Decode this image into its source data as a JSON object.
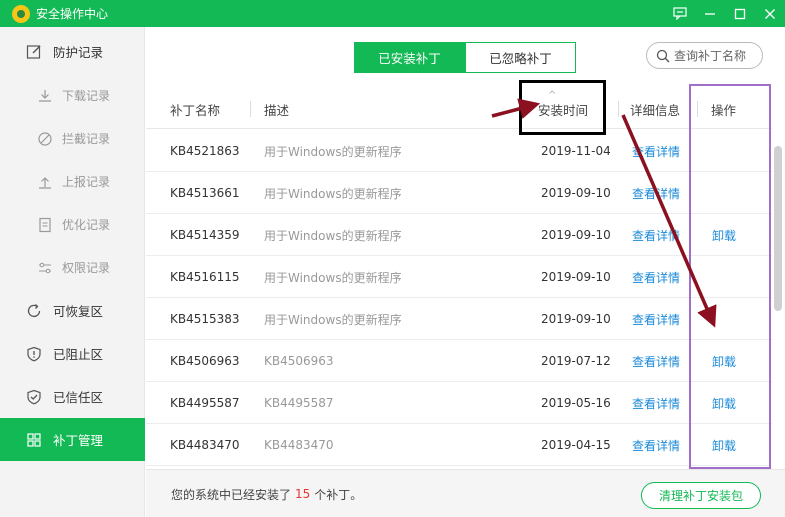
{
  "window": {
    "title": "安全操作中心"
  },
  "sidebar": {
    "items": [
      {
        "label": "防护记录",
        "icon": "edit-icon",
        "level": "top",
        "active": false
      },
      {
        "label": "下载记录",
        "icon": "download-icon",
        "level": "sub",
        "active": false
      },
      {
        "label": "拦截记录",
        "icon": "block-icon",
        "level": "sub",
        "active": false
      },
      {
        "label": "上报记录",
        "icon": "upload-icon",
        "level": "sub",
        "active": false
      },
      {
        "label": "优化记录",
        "icon": "document-icon",
        "level": "sub",
        "active": false
      },
      {
        "label": "权限记录",
        "icon": "sliders-icon",
        "level": "sub",
        "active": false
      },
      {
        "label": "可恢复区",
        "icon": "restore-icon",
        "level": "top",
        "active": false
      },
      {
        "label": "已阻止区",
        "icon": "shield-alert-icon",
        "level": "top",
        "active": false
      },
      {
        "label": "已信任区",
        "icon": "shield-check-icon",
        "level": "top",
        "active": false
      },
      {
        "label": "补丁管理",
        "icon": "grid-icon",
        "level": "top",
        "active": true
      }
    ]
  },
  "tabs": [
    {
      "label": "已安装补丁",
      "active": true
    },
    {
      "label": "已忽略补丁",
      "active": false
    }
  ],
  "search": {
    "placeholder": "查询补丁名称"
  },
  "table": {
    "columns": [
      "补丁名称",
      "描述",
      "安装时间",
      "详细信息",
      "操作"
    ],
    "rows": [
      {
        "name": "KB4521863",
        "desc": "用于Windows的更新程序",
        "date": "2019-11-04",
        "detail": "查看详情",
        "action": ""
      },
      {
        "name": "KB4513661",
        "desc": "用于Windows的更新程序",
        "date": "2019-09-10",
        "detail": "查看详情",
        "action": ""
      },
      {
        "name": "KB4514359",
        "desc": "用于Windows的更新程序",
        "date": "2019-09-10",
        "detail": "查看详情",
        "action": "卸载"
      },
      {
        "name": "KB4516115",
        "desc": "用于Windows的更新程序",
        "date": "2019-09-10",
        "detail": "查看详情",
        "action": ""
      },
      {
        "name": "KB4515383",
        "desc": "用于Windows的更新程序",
        "date": "2019-09-10",
        "detail": "查看详情",
        "action": ""
      },
      {
        "name": "KB4506963",
        "desc": "KB4506963",
        "date": "2019-07-12",
        "detail": "查看详情",
        "action": "卸载"
      },
      {
        "name": "KB4495587",
        "desc": "KB4495587",
        "date": "2019-05-16",
        "detail": "查看详情",
        "action": "卸载"
      },
      {
        "name": "KB4483470",
        "desc": "KB4483470",
        "date": "2019-04-15",
        "detail": "查看详情",
        "action": "卸载"
      }
    ]
  },
  "footer": {
    "text_before": "您的系统中已经安装了",
    "count": "15",
    "text_after": "个补丁。",
    "button": "清理补丁安装包"
  },
  "colors": {
    "brand_green": "#13b955",
    "link_blue": "#1a8ad8",
    "annotation_red": "#8b1020",
    "annotation_purple": "#a070c8"
  }
}
